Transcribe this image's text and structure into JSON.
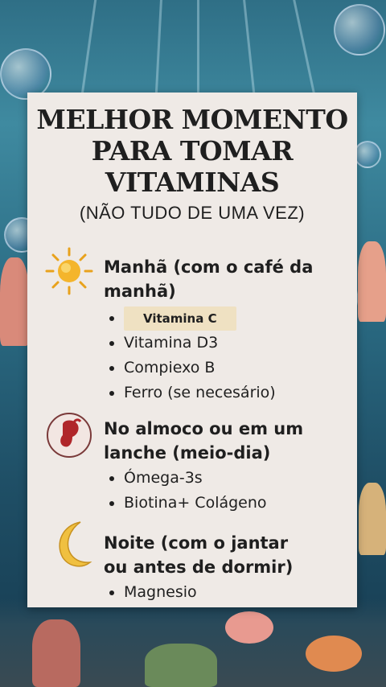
{
  "card": {
    "title_lines": [
      "MELHOR MOMENTO",
      "PARA TOMAR",
      "VITAMINAS"
    ],
    "subtitle": "(NÃO TUDO DE UMA VEZ)"
  },
  "sections": [
    {
      "icon": "sun-icon",
      "heading_lines": [
        "Manhã (com o café da",
        "manhã)"
      ],
      "items": [
        "Vitamina C",
        "Vitamina D3",
        "Compiexo B",
        "Ferro (se necesário)"
      ]
    },
    {
      "icon": "stomach-icon",
      "heading_lines": [
        "No almoco ou em um",
        "lanche (meio-dia)"
      ],
      "items": [
        "Ómega-3s",
        "Biotina+ Colágeno"
      ]
    },
    {
      "icon": "crescent-moon-icon",
      "heading_lines": [
        "Noite (com o jantar",
        "ou antes de dormir)"
      ],
      "items": [
        "Magnesio"
      ]
    }
  ],
  "colors": {
    "card_bg": "#efeae6",
    "highlight": "#efe1c2",
    "text": "#1f1f1f"
  }
}
